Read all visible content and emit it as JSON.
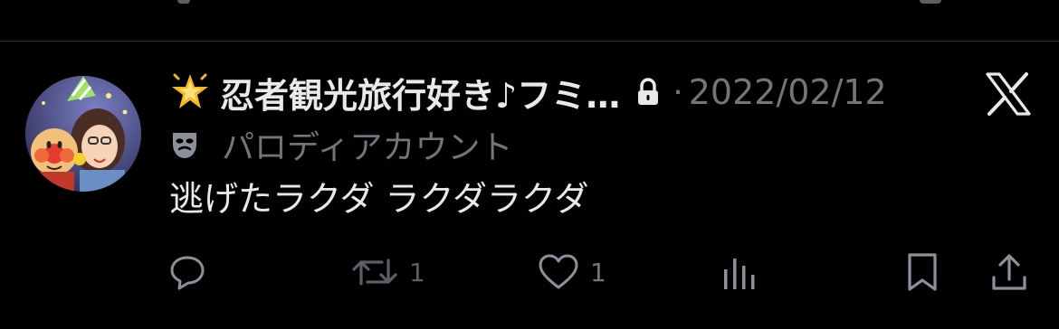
{
  "tweet": {
    "display_name": "忍者観光旅行好き♪フミ…",
    "separator": "·",
    "date": "2022/02/12",
    "label": "パロディアカウント",
    "text": "逃げたラクダ ラクダラクダ"
  },
  "actions": {
    "retweet_count": "1",
    "like_count": "1"
  },
  "icons": {
    "name_badge": "glowing-star-icon",
    "protected": "lock-icon",
    "label_badge": "theater-mask-icon",
    "platform": "x-logo-icon",
    "reply": "speech-bubble-icon",
    "retweet": "retweet-arrows-icon",
    "like": "heart-icon",
    "views": "bar-chart-icon",
    "bookmark": "bookmark-icon",
    "share": "share-upload-icon"
  },
  "colors": {
    "background": "#000000",
    "primary_text": "#e7e9ea",
    "secondary_text": "#71767b",
    "divider": "#2f3336",
    "star": "#f5b91e"
  }
}
